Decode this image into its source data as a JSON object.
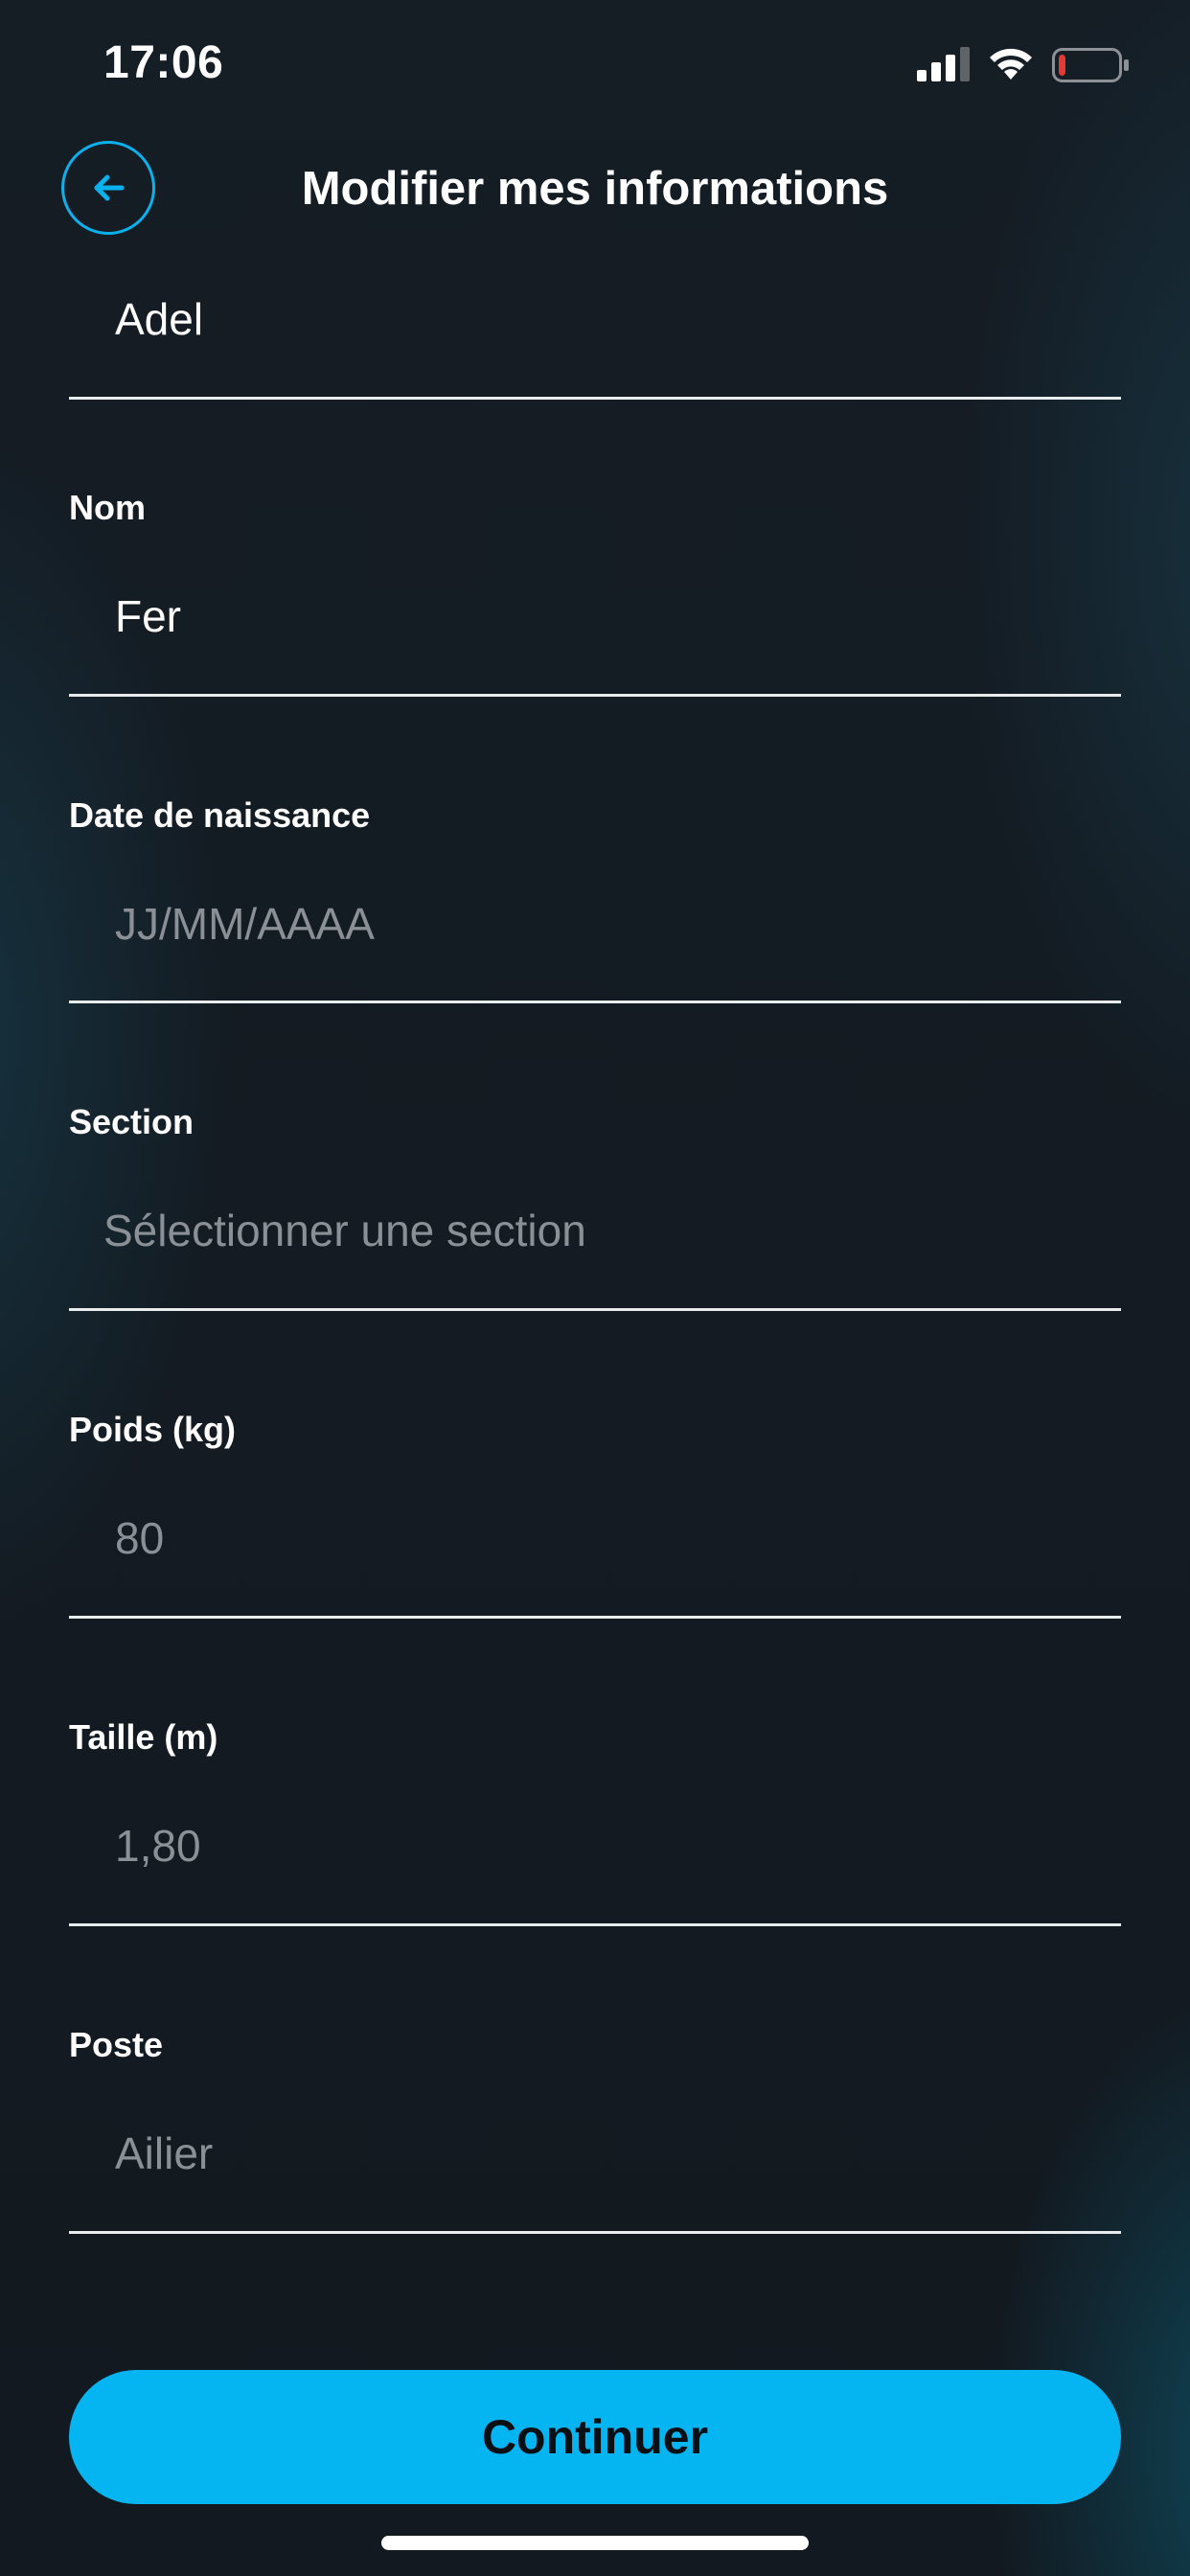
{
  "status_bar": {
    "time": "17:06",
    "signal_icon": "cellular-signal-icon",
    "wifi_icon": "wifi-icon",
    "battery_icon": "battery-low-icon",
    "battery_level": 0.12,
    "battery_color": "#e53935"
  },
  "header": {
    "back_icon": "arrow-left-icon",
    "title": "Modifier mes informations"
  },
  "form": {
    "prenom": {
      "value": "Adel"
    },
    "nom": {
      "label": "Nom",
      "value": "Fer"
    },
    "date_naissance": {
      "label": "Date de naissance",
      "placeholder": "JJ/MM/AAAA"
    },
    "section": {
      "label": "Section",
      "placeholder": "Sélectionner une section"
    },
    "poids": {
      "label": "Poids (kg)",
      "placeholder": "80"
    },
    "taille": {
      "label": "Taille (m)",
      "placeholder": "1,80"
    },
    "poste": {
      "label": "Poste",
      "placeholder": "Ailier"
    }
  },
  "actions": {
    "continue_label": "Continuer"
  },
  "colors": {
    "accent": "#04b5f2",
    "background": "#141b22",
    "placeholder": "#8a9096"
  }
}
